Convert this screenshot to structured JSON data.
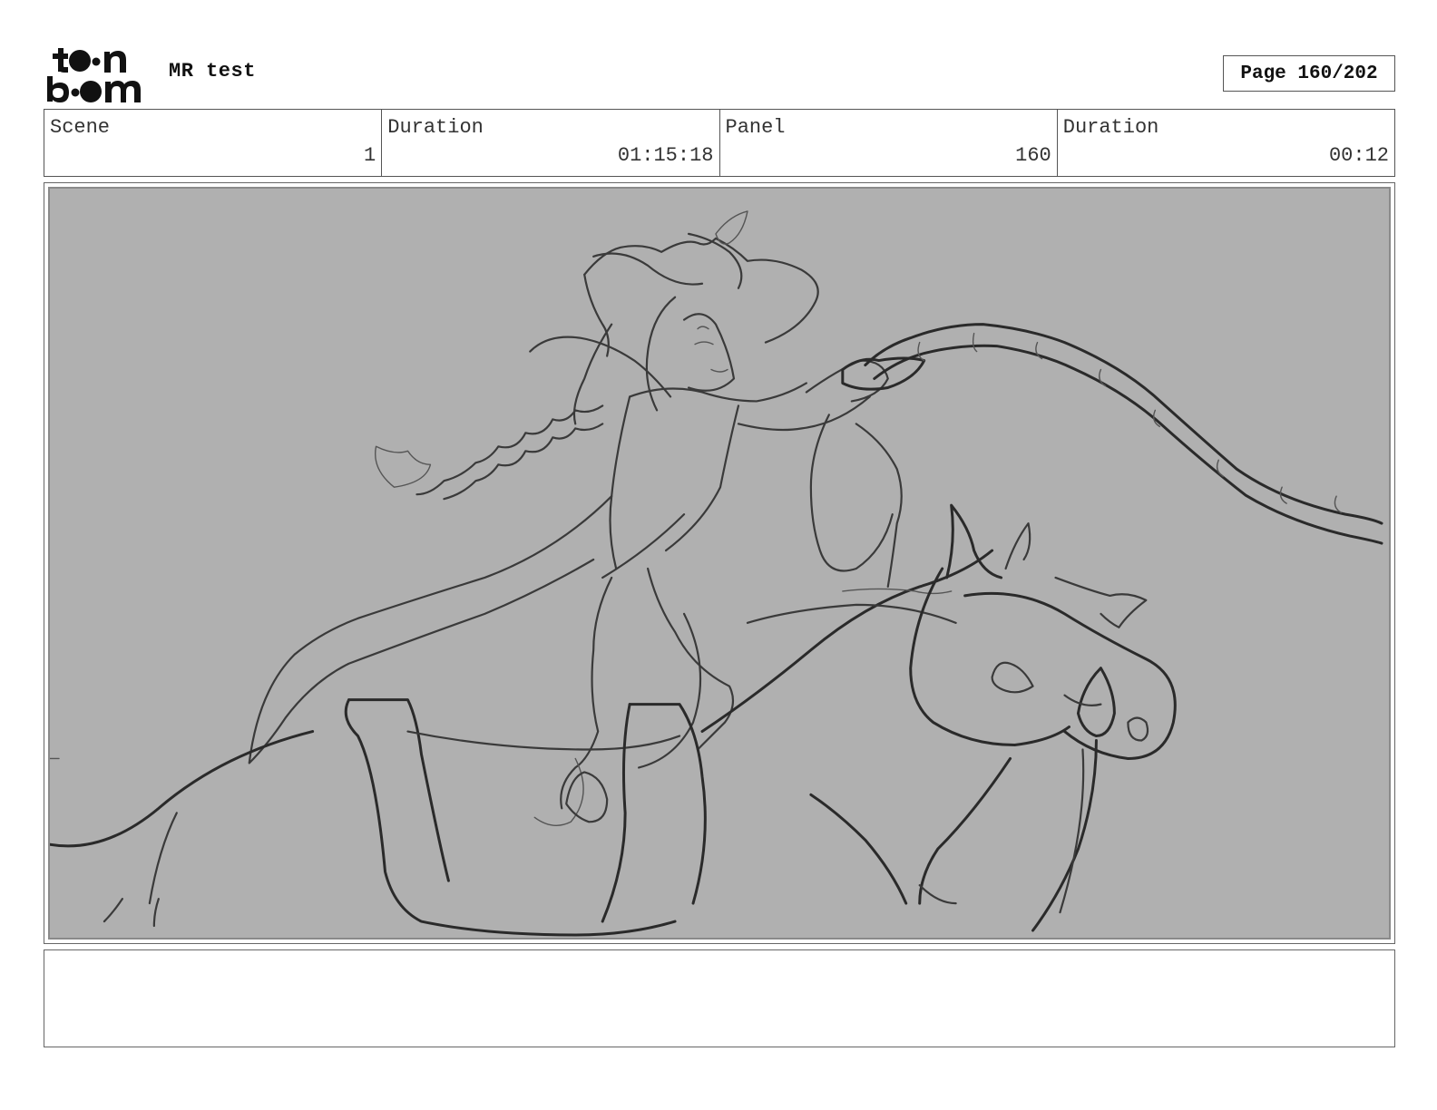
{
  "header": {
    "logo_text": "toonboom",
    "project_title": "MR test",
    "page_label": "Page 160/202"
  },
  "info": {
    "scene_label": "Scene",
    "scene_value": "1",
    "scene_duration_label": "Duration",
    "scene_duration_value": "01:15:18",
    "panel_label": "Panel",
    "panel_value": "160",
    "panel_duration_label": "Duration",
    "panel_duration_value": "00:12"
  },
  "colors": {
    "panel_background": "#b0b0b0",
    "sketch_line": "#3a3a3a"
  }
}
